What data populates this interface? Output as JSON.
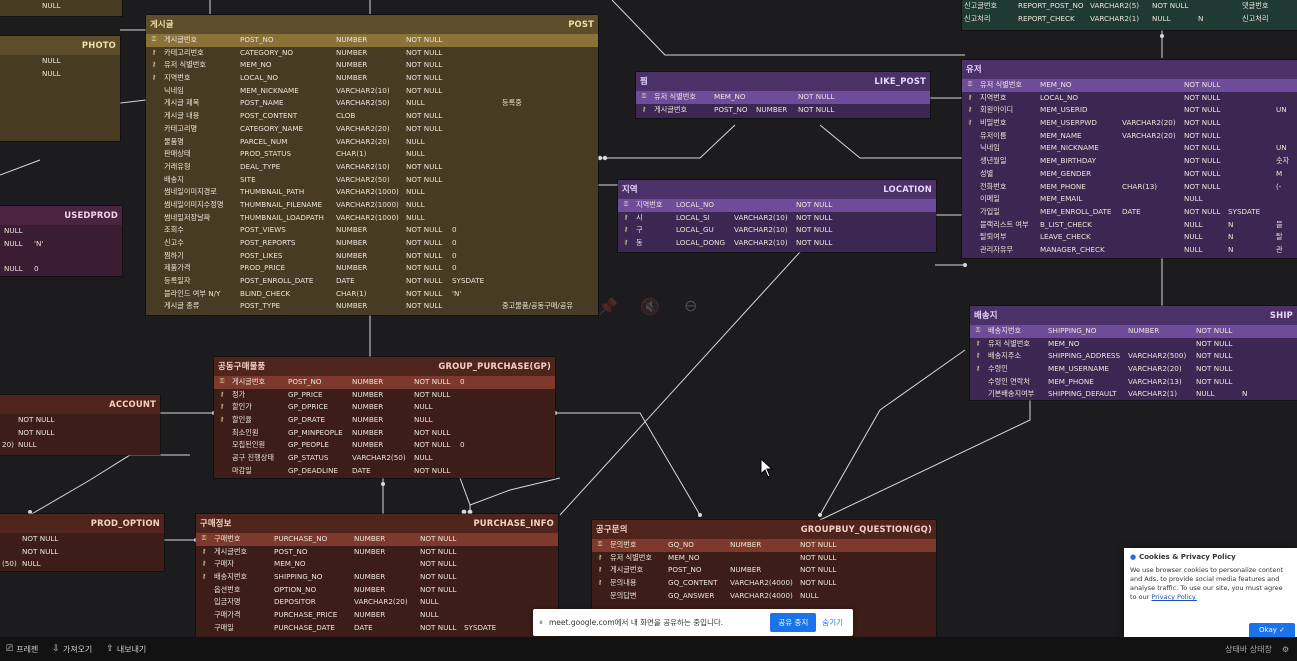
{
  "tables": {
    "photo": {
      "title_kr": "",
      "title_en": "PHOTO",
      "rows": [
        [
          "",
          "NULL",
          "",
          ""
        ],
        [
          "",
          "NULL",
          "",
          ""
        ],
        [
          "",
          "",
          "",
          ""
        ],
        [
          "",
          "",
          "",
          ""
        ],
        [
          "",
          "",
          "",
          ""
        ],
        [
          "",
          "",
          "",
          ""
        ],
        [
          "",
          "",
          "",
          ""
        ],
        [
          "",
          "",
          "",
          ""
        ]
      ]
    },
    "post": {
      "title_kr": "게시글",
      "title_en": "POST",
      "rows": [
        [
          "게시글번호",
          "POST_NO",
          "NUMBER",
          "NOT NULL",
          "",
          ""
        ],
        [
          "카테고리번호",
          "CATEGORY_NO",
          "NUMBER",
          "NOT NULL",
          "",
          ""
        ],
        [
          "유저 식별번호",
          "MEM_NO",
          "NUMBER",
          "NOT NULL",
          "",
          ""
        ],
        [
          "지역번호",
          "LOCAL_NO",
          "NUMBER",
          "NOT NULL",
          "",
          ""
        ],
        [
          "닉네임",
          "MEM_NICKNAME",
          "VARCHAR2(10)",
          "NOT NULL",
          "",
          ""
        ],
        [
          "게시글 제목",
          "POST_NAME",
          "VARCHAR2(50)",
          "NULL",
          "",
          "등록중"
        ],
        [
          "게시글 내용",
          "POST_CONTENT",
          "CLOB",
          "NOT NULL",
          "",
          ""
        ],
        [
          "카테고리명",
          "CATEGORY_NAME",
          "VARCHAR2(20)",
          "NOT NULL",
          "",
          ""
        ],
        [
          "물품명",
          "PARCEL_NUM",
          "VARCHAR2(20)",
          "NULL",
          "",
          ""
        ],
        [
          "판매상태",
          "PROD_STATUS",
          "CHAR(1)",
          "NULL",
          "",
          ""
        ],
        [
          "거래유형",
          "DEAL_TYPE",
          "VARCHAR2(10)",
          "NOT NULL",
          "",
          ""
        ],
        [
          "배송지",
          "SITE",
          "VARCHAR2(50)",
          "NOT NULL",
          "",
          ""
        ],
        [
          "썸네일이미지경로",
          "THUMBNAIL_PATH",
          "VARCHAR2(1000)",
          "NULL",
          "",
          ""
        ],
        [
          "썸네일이미지수정명",
          "THUMBNAIL_FILENAME",
          "VARCHAR2(1000)",
          "NULL",
          "",
          ""
        ],
        [
          "썸네일저장날짜",
          "THUMBNAIL_LOADPATH",
          "VARCHAR2(1000)",
          "NULL",
          "",
          ""
        ],
        [
          "조회수",
          "POST_VIEWS",
          "NUMBER",
          "NOT NULL",
          "0",
          ""
        ],
        [
          "신고수",
          "POST_REPORTS",
          "NUMBER",
          "NOT NULL",
          "0",
          ""
        ],
        [
          "찜하기",
          "POST_LIKES",
          "NUMBER",
          "NOT NULL",
          "0",
          ""
        ],
        [
          "제품가격",
          "PROD_PRICE",
          "NUMBER",
          "NOT NULL",
          "0",
          ""
        ],
        [
          "등록일자",
          "POST_ENROLL_DATE",
          "DATE",
          "NOT NULL",
          "SYSDATE",
          ""
        ],
        [
          "블라인드 여부 N/Y",
          "BLIND_CHECK",
          "CHAR(1)",
          "NOT NULL",
          "'N'",
          ""
        ],
        [
          "게시글 종류",
          "POST_TYPE",
          "NUMBER",
          "NOT NULL",
          "",
          "중고물품/공동구매/공유"
        ]
      ]
    },
    "used_prod": {
      "title_kr": "",
      "title_en": "USEDPROD",
      "rows": [
        [
          "",
          "NULL",
          "",
          ""
        ],
        [
          "",
          "NULL",
          "'N'",
          ""
        ],
        [
          "",
          "",
          "",
          ""
        ],
        [
          "",
          "NULL",
          "0",
          ""
        ]
      ]
    },
    "like_post": {
      "title_kr": "찜",
      "title_en": "LIKE_POST",
      "rows": [
        [
          "유저 식별번호",
          "MEM_NO",
          "",
          "NOT NULL"
        ],
        [
          "게시글번호",
          "POST_NO",
          "NUMBER",
          "NOT NULL"
        ]
      ]
    },
    "location": {
      "title_kr": "지역",
      "title_en": "LOCATION",
      "rows": [
        [
          "지역번호",
          "LOCAL_NO",
          "",
          "NOT NULL"
        ],
        [
          "시",
          "LOCAL_SI",
          "VARCHAR2(10)",
          "NOT NULL"
        ],
        [
          "구",
          "LOCAL_GU",
          "VARCHAR2(10)",
          "NOT NULL"
        ],
        [
          "동",
          "LOCAL_DONG",
          "VARCHAR2(10)",
          "NOT NULL"
        ]
      ]
    },
    "report": {
      "rows": [
        [
          "신고글번호",
          "REPORT_POST_NO",
          "VARCHAR2(5)",
          "NOT NULL",
          "",
          "댓글번호"
        ],
        [
          "신고처리",
          "REPORT_CHECK",
          "VARCHAR2(1)",
          "NULL",
          "N",
          "신고처리"
        ]
      ]
    },
    "member": {
      "title_kr": "유저",
      "title_en": "",
      "rows": [
        [
          "유저 식별번호",
          "MEM_NO",
          "",
          "NOT NULL",
          "",
          ""
        ],
        [
          "지역번호",
          "LOCAL_NO",
          "",
          "NOT NULL",
          "",
          ""
        ],
        [
          "회원아이디",
          "MEM_USERID",
          "",
          "NOT NULL",
          "",
          "UN"
        ],
        [
          "비밀번호",
          "MEM_USERPWD",
          "VARCHAR2(20)",
          "NOT NULL",
          "",
          ""
        ],
        [
          "유저이름",
          "MEM_NAME",
          "VARCHAR2(20)",
          "NOT NULL",
          "",
          ""
        ],
        [
          "닉네임",
          "MEM_NICKNAME",
          "",
          "NOT NULL",
          "",
          "UN"
        ],
        [
          "생년월일",
          "MEM_BIRTHDAY",
          "",
          "NOT NULL",
          "",
          "숫자"
        ],
        [
          "성별",
          "MEM_GENDER",
          "",
          "NOT NULL",
          "",
          "M"
        ],
        [
          "전화번호",
          "MEM_PHONE",
          "CHAR(13)",
          "NOT NULL",
          "",
          "(-"
        ],
        [
          "이메일",
          "MEM_EMAIL",
          "",
          "NULL",
          "",
          ""
        ],
        [
          "가입일",
          "MEM_ENROLL_DATE",
          "DATE",
          "NOT NULL",
          "SYSDATE",
          ""
        ],
        [
          "블랙리스트 여부",
          "B_LIST_CHECK",
          "",
          "NULL",
          "N",
          "블"
        ],
        [
          "탈퇴여부",
          "LEAVE_CHECK",
          "",
          "NULL",
          "N",
          "탈"
        ],
        [
          "관리자유무",
          "MANAGER_CHECK",
          "",
          "NULL",
          "N",
          "관"
        ]
      ]
    },
    "shipping": {
      "title_kr": "배송지",
      "title_en": "SHIP",
      "rows": [
        [
          "배송지번호",
          "SHIPPING_NO",
          "NUMBER",
          "NOT NULL",
          ""
        ],
        [
          "유저 식별번호",
          "MEM_NO",
          "",
          "NOT NULL",
          ""
        ],
        [
          "배송지주소",
          "SHIPPING_ADDRESS",
          "VARCHAR2(500)",
          "NOT NULL",
          ""
        ],
        [
          "수령인",
          "MEM_USERNAME",
          "VARCHAR2(20)",
          "NOT NULL",
          ""
        ],
        [
          "수령인 연락처",
          "MEM_PHONE",
          "VARCHAR2(13)",
          "NOT NULL",
          ""
        ],
        [
          "기본배송지여부",
          "SHIPPING_DEFAULT",
          "VARCHAR2(1)",
          "NULL",
          "N"
        ]
      ]
    },
    "group_purchase": {
      "title_kr": "공동구매물품",
      "title_en": "GROUP_PURCHASE(GP)",
      "rows": [
        [
          "게시글번호",
          "POST_NO",
          "NUMBER",
          "NOT NULL",
          "0"
        ],
        [
          "정가",
          "GP_PRICE",
          "NUMBER",
          "NOT NULL",
          ""
        ],
        [
          "할인가",
          "GP_DPRICE",
          "NUMBER",
          "NULL",
          ""
        ],
        [
          "할인율",
          "GP_DRATE",
          "NUMBER",
          "NULL",
          ""
        ],
        [
          "최소인원",
          "GP_MINPEOPLE",
          "NUMBER",
          "NOT NULL",
          ""
        ],
        [
          "모집된인원",
          "GP_PEOPLE",
          "NUMBER",
          "NOT NULL",
          "0"
        ],
        [
          "공구 진행상태",
          "GP_STATUS",
          "VARCHAR2(50)",
          "NULL",
          ""
        ],
        [
          "마감일",
          "GP_DEADLINE",
          "DATE",
          "NOT NULL",
          ""
        ]
      ]
    },
    "account": {
      "title_kr": "",
      "title_en": "ACCOUNT",
      "rows": [
        [
          "",
          "NOT NULL",
          "",
          ""
        ],
        [
          "",
          "NOT NULL",
          "",
          ""
        ],
        [
          "20)",
          "NULL",
          "",
          ""
        ]
      ]
    },
    "prod_option": {
      "title_kr": "",
      "title_en": "PROD_OPTION",
      "rows": [
        [
          "",
          "NOT NULL",
          "",
          ""
        ],
        [
          "",
          "NOT NULL",
          "",
          ""
        ],
        [
          "(50)",
          "NULL",
          "",
          ""
        ]
      ]
    },
    "purchase_info": {
      "title_kr": "구매정보",
      "title_en": "PURCHASE_INFO",
      "rows": [
        [
          "구매번호",
          "PURCHASE_NO",
          "NUMBER",
          "NOT NULL",
          ""
        ],
        [
          "게시글번호",
          "POST_NO",
          "NUMBER",
          "NOT NULL",
          ""
        ],
        [
          "구매자",
          "MEM_NO",
          "",
          "NOT NULL",
          ""
        ],
        [
          "배송지번호",
          "SHIPPING_NO",
          "NUMBER",
          "NOT NULL",
          ""
        ],
        [
          "옵션번호",
          "OPTION_NO",
          "NUMBER",
          "NOT NULL",
          ""
        ],
        [
          "입금자명",
          "DEPOSITOR",
          "VARCHAR2(20)",
          "NULL",
          ""
        ],
        [
          "구매가격",
          "PURCHASE_PRICE",
          "NUMBER",
          "NULL",
          ""
        ],
        [
          "구매일",
          "PURCHASE_DATE",
          "DATE",
          "NOT NULL",
          "SYSDATE"
        ]
      ]
    },
    "groupbuy_question": {
      "title_kr": "공구문의",
      "title_en": "GROUPBUY_QUESTION(GQ)",
      "rows": [
        [
          "문의번호",
          "GQ_NO",
          "NUMBER",
          "NOT NULL"
        ],
        [
          "유저 식별번호",
          "MEM_NO",
          "",
          "NOT NULL"
        ],
        [
          "게시글번호",
          "POST_NO",
          "NUMBER",
          "NOT NULL"
        ],
        [
          "문의내용",
          "GQ_CONTENT",
          "VARCHAR2(4000)",
          "NOT NULL"
        ],
        [
          "문의답변",
          "GQ_ANSWER",
          "VARCHAR2(4000)",
          "NULL"
        ],
        [
          "",
          "",
          "",
          ""
        ]
      ]
    }
  },
  "share_bar": {
    "message": "meet.google.com에서 내 화면을 공유하는 중입니다.",
    "stop_label": "공유 중지",
    "hide_label": "숨기기"
  },
  "cookie": {
    "title": "Cookies & Privacy Policy",
    "body": "We use browser cookies to personalize content and Ads, to provide social media features and analyse traffic. To use our site, you must agree to our",
    "link": "Privacy Policy.",
    "ok_label": "Okay"
  },
  "taskbar": {
    "item1": "프레젠",
    "item2": "가져오기",
    "item3": "내보내기",
    "right_text": "상태바 상태창"
  },
  "colors": {
    "canvas": "#1c1b1d",
    "gold": "#5d4d2a",
    "purple": "#4b3167",
    "brown": "#4f241c",
    "link_line": "#dcdcdc",
    "accent": "#1a73e8"
  }
}
